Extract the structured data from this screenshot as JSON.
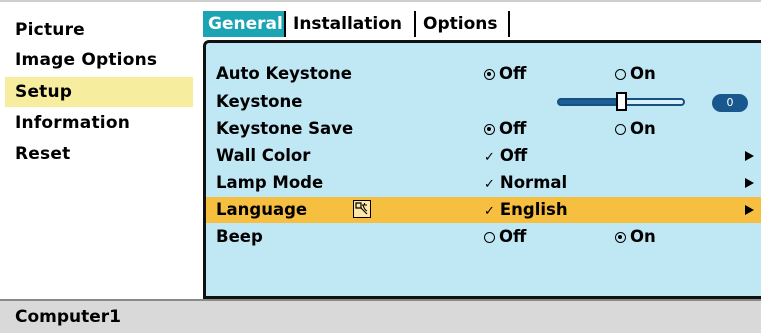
{
  "left_menu": {
    "items": [
      {
        "label": "Picture"
      },
      {
        "label": "Image Options"
      },
      {
        "label": "Setup",
        "selected": true
      },
      {
        "label": "Information"
      },
      {
        "label": "Reset"
      }
    ]
  },
  "tabs": [
    {
      "label": "General",
      "active": true
    },
    {
      "label": "Installation"
    },
    {
      "label": "Options"
    }
  ],
  "settings": {
    "auto_keystone": {
      "label": "Auto Keystone",
      "off": "Off",
      "on": "On",
      "selected": "Off"
    },
    "keystone": {
      "label": "Keystone",
      "value": "0",
      "level": 0.5
    },
    "keystone_save": {
      "label": "Keystone Save",
      "off": "Off",
      "on": "On",
      "selected": "Off"
    },
    "wall_color": {
      "label": "Wall Color",
      "value": "Off"
    },
    "lamp_mode": {
      "label": "Lamp Mode",
      "value": "Normal"
    },
    "language": {
      "label": "Language",
      "value": "English",
      "selected": true,
      "icon": "language-icon"
    },
    "beep": {
      "label": "Beep",
      "off": "Off",
      "on": "On",
      "selected": "On"
    }
  },
  "status_bar": {
    "source": "Computer1"
  },
  "colors": {
    "panel_bg": "#bfe7f4",
    "active_tab": "#1aa4b4",
    "selected_row": "#f7bf3f",
    "left_selected": "#f6ee9e",
    "slider_fill": "#1c5f96"
  }
}
